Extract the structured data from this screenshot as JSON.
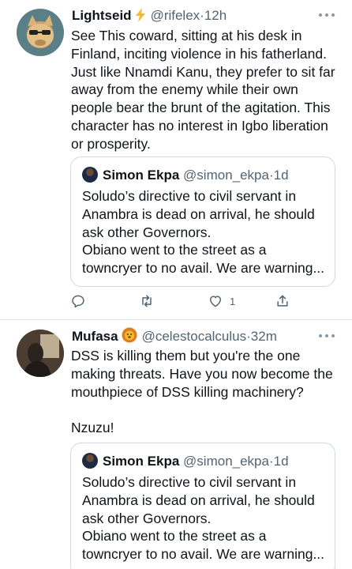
{
  "tweets": [
    {
      "name": "Lightseid",
      "badge_icon": "lightning-icon",
      "handle": "@rifelex",
      "dot": "·",
      "time": "12h",
      "lines": [
        "See This coward, sitting at his desk in",
        "Finland, inciting violence in his fatherland.",
        "Just like Nnamdi Kanu, they prefer to sit far",
        "away from the enemy while their own",
        "people bear the brunt of the agitation. This",
        "character has no interest in Igbo liberation",
        "or prosperity."
      ],
      "quote": {
        "name": "Simon Ekpa",
        "handle": "@simon_ekpa",
        "dot": "·",
        "time": "1d",
        "lines": [
          "Soludo’s directive to civil servant in",
          "Anambra is dead on arrival, he should",
          "ask other Governors.",
          "Obiano went to the street as a",
          "towncryer to no avail. We are warning..."
        ]
      },
      "actions": {
        "like_count": "1"
      }
    },
    {
      "name": "Mufasa",
      "badge_icon": "lion-icon",
      "handle": "@celestocalculus",
      "dot": "·",
      "time": "32m",
      "lines": [
        "DSS is killing them but you're the one",
        "making threats. Have you now become the",
        "mouthpiece of DSS killing machinery?",
        "",
        "Nzuzu!"
      ],
      "quote": {
        "name": "Simon Ekpa",
        "handle": "@simon_ekpa",
        "dot": "·",
        "time": "1d",
        "lines": [
          "Soludo’s directive to civil servant in",
          "Anambra is dead on arrival, he should",
          "ask other Governors.",
          "Obiano went to the street as a",
          "towncryer to no avail. We are warning..."
        ]
      }
    }
  ],
  "colors": {
    "text": "#0f1419",
    "secondary": "#536471",
    "border": "#cfd9de",
    "badge": "#f7b928"
  }
}
